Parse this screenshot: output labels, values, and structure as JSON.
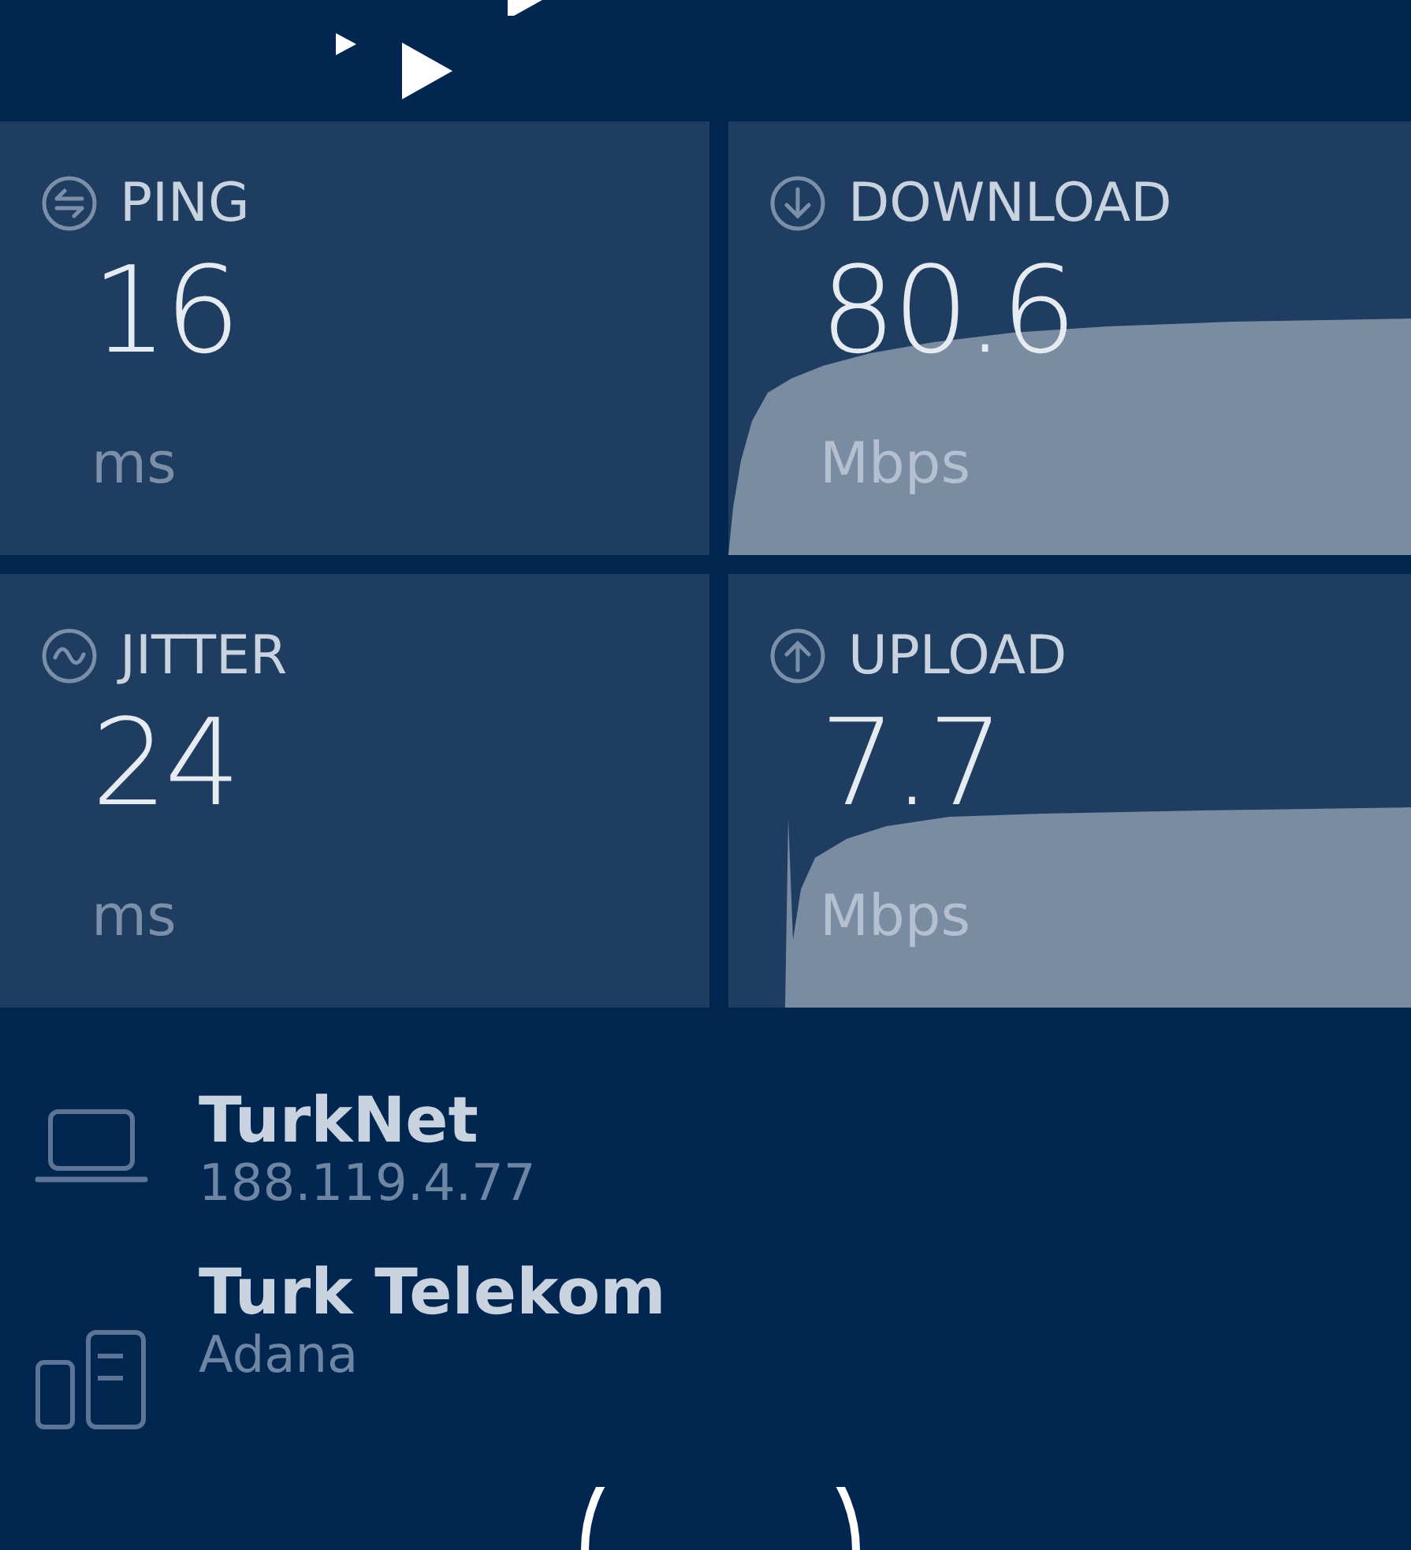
{
  "metrics": [
    {
      "kind": "ping",
      "label": "PING",
      "value": "16",
      "unit": "ms"
    },
    {
      "kind": "download",
      "label": "DOWNLOAD",
      "value": "80.6",
      "unit": "Mbps"
    },
    {
      "kind": "jitter",
      "label": "JITTER",
      "value": "24",
      "unit": "ms"
    },
    {
      "kind": "upload",
      "label": "UPLOAD",
      "value": "7.7",
      "unit": "Mbps"
    }
  ],
  "connections": [
    {
      "kind": "client",
      "name": "TurkNet",
      "detail": "188.119.4.77"
    },
    {
      "kind": "server",
      "name": "Turk Telekom",
      "detail": "Adana"
    }
  ]
}
